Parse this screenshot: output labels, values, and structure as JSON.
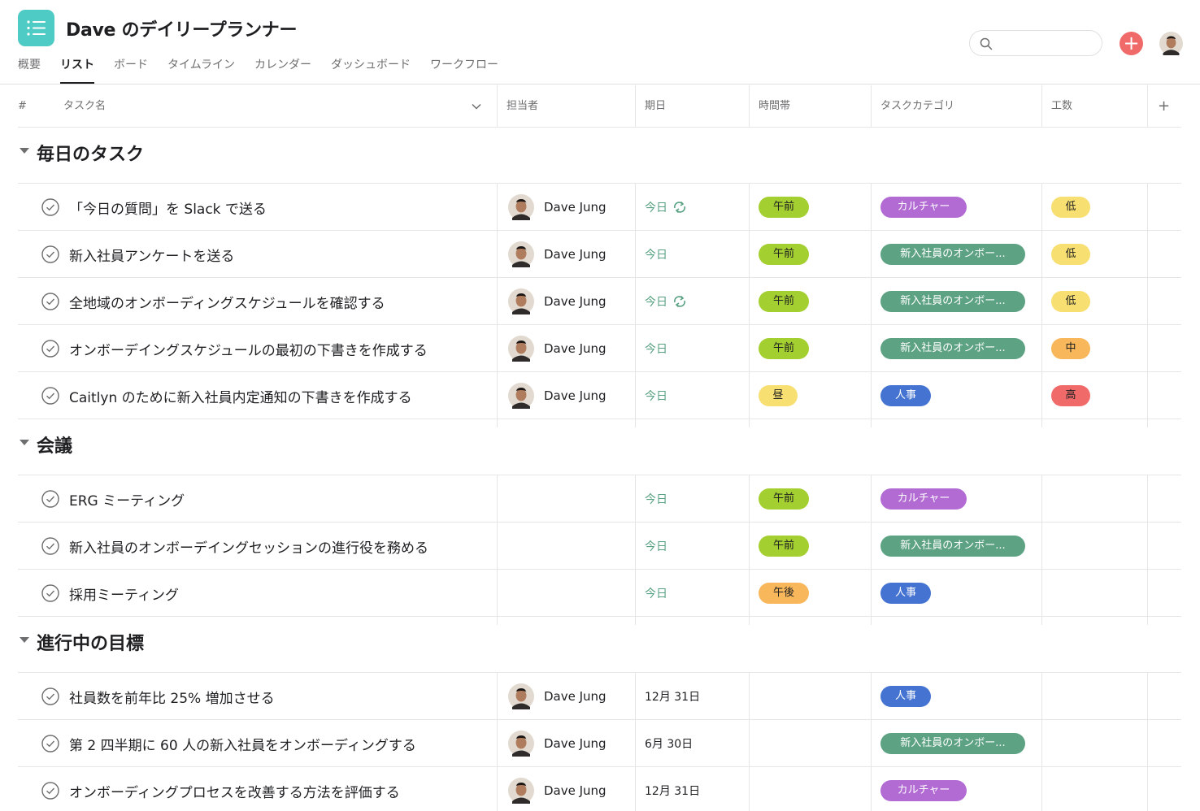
{
  "project": {
    "title": "Dave のデイリープランナー",
    "icon": "list-icon",
    "icon_color": "#4ecbc4"
  },
  "tabs": [
    {
      "label": "概要",
      "active": false
    },
    {
      "label": "リスト",
      "active": true
    },
    {
      "label": "ボード",
      "active": false
    },
    {
      "label": "タイムライン",
      "active": false
    },
    {
      "label": "カレンダー",
      "active": false
    },
    {
      "label": "ダッシュボード",
      "active": false
    },
    {
      "label": "ワークフロー",
      "active": false
    }
  ],
  "search": {
    "placeholder": "",
    "value": ""
  },
  "add_button": {
    "label": "+",
    "color": "#f06a6a"
  },
  "columns": {
    "number": "#",
    "task_name": "タスク名",
    "assignee": "担当者",
    "due": "期日",
    "time_slot": "時間帯",
    "category": "タスクカテゴリ",
    "effort": "工数",
    "add_column": "+"
  },
  "colors": {
    "today_text": "#58a182",
    "am": "#a4cf30",
    "noon": "#f8df72",
    "pm": "#f8b75a",
    "culture": "#b36bd4",
    "onboarding": "#5da283",
    "hr": "#4573d2",
    "effort_low": "#f8df72",
    "effort_mid": "#f8b75a",
    "effort_high": "#f06a6a"
  },
  "sections": [
    {
      "title": "毎日のタスク",
      "tasks": [
        {
          "name": "「今日の質問」を Slack で送る",
          "assignee": "Dave Jung",
          "due": "今日",
          "recurring": true,
          "time": "午前",
          "category": "カルチャー",
          "effort": "低"
        },
        {
          "name": "新入社員アンケートを送る",
          "assignee": "Dave Jung",
          "due": "今日",
          "recurring": false,
          "time": "午前",
          "category": "新入社員のオンボー...",
          "effort": "低"
        },
        {
          "name": "全地域のオンボーディングスケジュールを確認する",
          "assignee": "Dave Jung",
          "due": "今日",
          "recurring": true,
          "time": "午前",
          "category": "新入社員のオンボー...",
          "effort": "低"
        },
        {
          "name": "オンボーデイングスケジュールの最初の下書きを作成する",
          "assignee": "Dave Jung",
          "due": "今日",
          "recurring": false,
          "time": "午前",
          "category": "新入社員のオンボー...",
          "effort": "中"
        },
        {
          "name": "Caitlyn のために新入社員内定通知の下書きを作成する",
          "assignee": "Dave Jung",
          "due": "今日",
          "recurring": false,
          "time": "昼",
          "category": "人事",
          "effort": "高"
        }
      ]
    },
    {
      "title": "会議",
      "tasks": [
        {
          "name": "ERG ミーティング",
          "assignee": "",
          "due": "今日",
          "recurring": false,
          "time": "午前",
          "category": "カルチャー",
          "effort": ""
        },
        {
          "name": "新入社員のオンボーデイングセッションの進行役を務める",
          "assignee": "",
          "due": "今日",
          "recurring": false,
          "time": "午前",
          "category": "新入社員のオンボー...",
          "effort": ""
        },
        {
          "name": "採用ミーティング",
          "assignee": "",
          "due": "今日",
          "recurring": false,
          "time": "午後",
          "category": "人事",
          "effort": ""
        }
      ]
    },
    {
      "title": "進行中の目標",
      "tasks": [
        {
          "name": "社員数を前年比 25% 増加させる",
          "assignee": "Dave Jung",
          "due": "12月 31日",
          "recurring": false,
          "time": "",
          "category": "人事",
          "effort": ""
        },
        {
          "name": "第 2 四半期に 60 人の新入社員をオンボーディングする",
          "assignee": "Dave Jung",
          "due": "6月 30日",
          "recurring": false,
          "time": "",
          "category": "新入社員のオンボー...",
          "effort": ""
        },
        {
          "name": "オンボーディングプロセスを改善する方法を評価する",
          "assignee": "Dave Jung",
          "due": "12月 31日",
          "recurring": false,
          "time": "",
          "category": "カルチャー",
          "effort": ""
        }
      ]
    }
  ]
}
